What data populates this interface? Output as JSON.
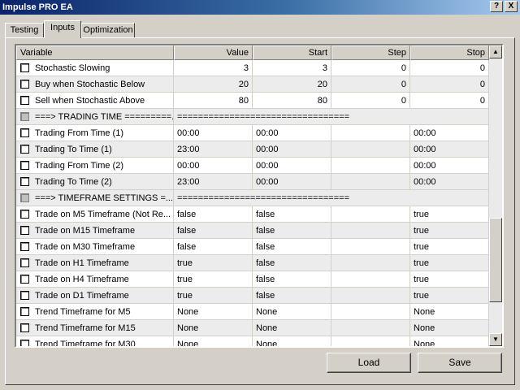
{
  "window": {
    "title": "Impulse PRO EA",
    "help_label": "?",
    "close_label": "X"
  },
  "tabs": [
    {
      "label": "Testing"
    },
    {
      "label": "Inputs"
    },
    {
      "label": "Optimization"
    }
  ],
  "table": {
    "columns": [
      "Variable",
      "Value",
      "Start",
      "Step",
      "Stop"
    ],
    "rows": [
      {
        "name": "Stochastic Slowing",
        "value": "3",
        "start": "3",
        "step": "0",
        "stop": "0"
      },
      {
        "name": "Buy when Stochastic Below",
        "value": "20",
        "start": "20",
        "step": "0",
        "stop": "0"
      },
      {
        "name": "Sell when Stochastic Above",
        "value": "80",
        "start": "80",
        "step": "0",
        "stop": "0"
      },
      {
        "name": "===> TRADING TIME =========...",
        "value": "================================="
      },
      {
        "name": "Trading From Time (1)",
        "value": "00:00",
        "start": "00:00",
        "step": "",
        "stop": "00:00"
      },
      {
        "name": "Trading To Time (1)",
        "value": "23:00",
        "start": "00:00",
        "step": "",
        "stop": "00:00"
      },
      {
        "name": "Trading From Time (2)",
        "value": "00:00",
        "start": "00:00",
        "step": "",
        "stop": "00:00"
      },
      {
        "name": "Trading To Time (2)",
        "value": "23:00",
        "start": "00:00",
        "step": "",
        "stop": "00:00"
      },
      {
        "name": "===> TIMEFRAME SETTINGS =...",
        "value": "================================="
      },
      {
        "name": "Trade on M5 Timeframe (Not Re...",
        "value": "false",
        "start": "false",
        "step": "",
        "stop": "true"
      },
      {
        "name": "Trade on M15 Timeframe",
        "value": "false",
        "start": "false",
        "step": "",
        "stop": "true"
      },
      {
        "name": "Trade on M30 Timeframe",
        "value": "false",
        "start": "false",
        "step": "",
        "stop": "true"
      },
      {
        "name": "Trade on H1 Timeframe",
        "value": "true",
        "start": "false",
        "step": "",
        "stop": "true"
      },
      {
        "name": "Trade on H4 Timeframe",
        "value": "true",
        "start": "false",
        "step": "",
        "stop": "true"
      },
      {
        "name": "Trade on D1 Timeframe",
        "value": "true",
        "start": "false",
        "step": "",
        "stop": "true"
      },
      {
        "name": "Trend Timeframe for M5",
        "value": "None",
        "start": "None",
        "step": "",
        "stop": "None"
      },
      {
        "name": "Trend Timeframe for M15",
        "value": "None",
        "start": "None",
        "step": "",
        "stop": "None"
      },
      {
        "name": "Trend Timeframe for M30",
        "value": "None",
        "start": "None",
        "step": "",
        "stop": "None"
      }
    ]
  },
  "buttons": {
    "load": "Load",
    "save": "Save"
  },
  "scrollbar": {
    "up_glyph": "▲",
    "down_glyph": "▼"
  }
}
